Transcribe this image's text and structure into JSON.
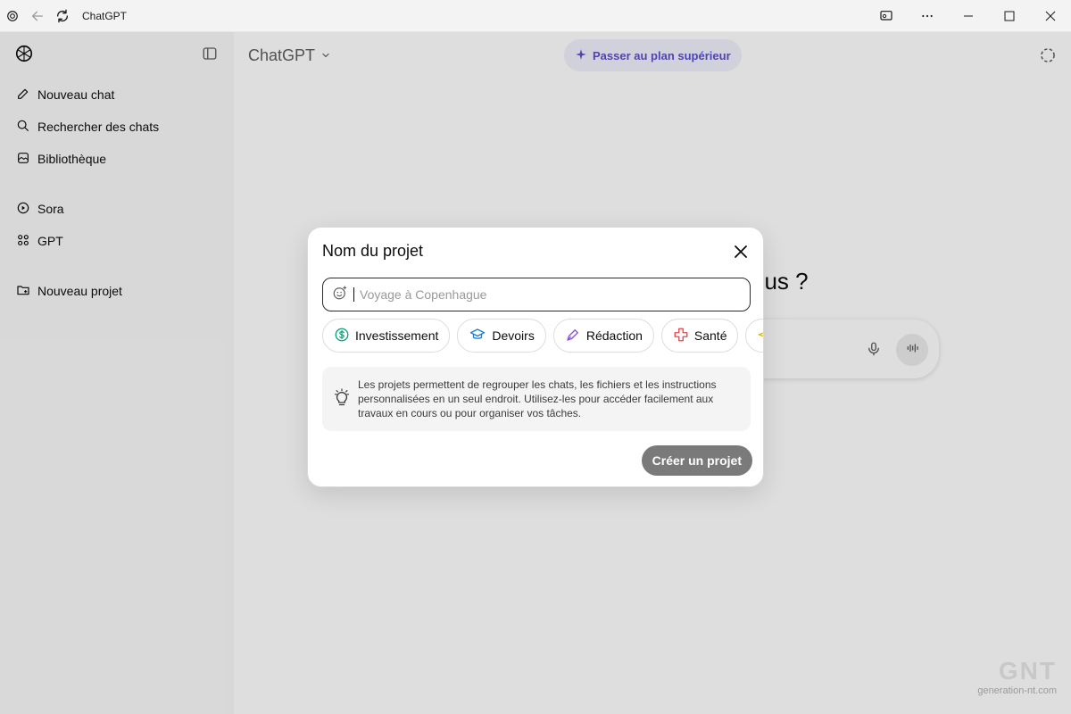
{
  "window": {
    "title": "ChatGPT",
    "icons": [
      "chatgpt-logo-icon",
      "back-arrow-icon",
      "refresh-icon"
    ],
    "controls": [
      "cast-icon",
      "more-icon",
      "minimize-icon",
      "maximize-icon",
      "close-icon"
    ]
  },
  "sidebar": {
    "items": [
      {
        "label": "Nouveau chat",
        "icon": "edit-icon"
      },
      {
        "label": "Rechercher des chats",
        "icon": "search-icon"
      },
      {
        "label": "Bibliothèque",
        "icon": "library-icon"
      },
      {
        "label": "Sora",
        "icon": "play-icon"
      },
      {
        "label": "GPT",
        "icon": "grid-icon"
      },
      {
        "label": "Nouveau projet",
        "icon": "folder-plus-icon"
      }
    ]
  },
  "main": {
    "model_label": "ChatGPT",
    "upgrade_label": "Passer au plan supérieur",
    "hero_partial": "ous ?"
  },
  "modal": {
    "title": "Nom du projet",
    "input_placeholder": "Voyage à Copenhague",
    "chips": [
      {
        "label": "Investissement",
        "icon": "dollar-icon",
        "color": "#10a37f"
      },
      {
        "label": "Devoirs",
        "icon": "graduation-cap-icon",
        "color": "#1a7fd4"
      },
      {
        "label": "Rédaction",
        "icon": "pen-icon",
        "color": "#8a4fd8"
      },
      {
        "label": "Santé",
        "icon": "health-icon",
        "color": "#e5484d"
      },
      {
        "label": "",
        "icon": "plane-icon",
        "color": "#e6b800"
      }
    ],
    "info_text": "Les projets permettent de regrouper les chats, les fichiers et les instructions personnalisées en un seul endroit. Utilisez-les pour accéder facilement aux travaux en cours ou pour organiser vos tâches.",
    "create_label": "Créer un projet"
  },
  "watermark": {
    "logo": "GNT",
    "url": "generation-nt.com"
  }
}
